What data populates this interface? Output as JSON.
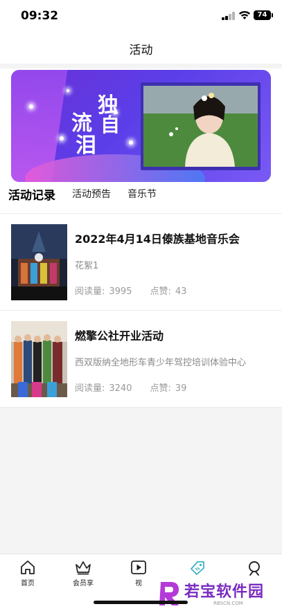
{
  "status_bar": {
    "time": "09:32",
    "battery": "74"
  },
  "header": {
    "title": "活动"
  },
  "banner": {
    "title_chars": [
      "独",
      "流",
      "自",
      "泪"
    ],
    "accent_color": "#6b2fd6"
  },
  "tabs": [
    {
      "label": "活动记录",
      "active": true
    },
    {
      "label": "活动预告",
      "active": false
    },
    {
      "label": "音乐节",
      "active": false
    }
  ],
  "activities": [
    {
      "title": "2022年4月14日傣族基地音乐会",
      "subtitle": "花絮1",
      "views_label": "阅读量:",
      "views": "3995",
      "likes_label": "点赞:",
      "likes": "43"
    },
    {
      "title": "燃擎公社开业活动",
      "subtitle": "西双版纳全地形车青少年驾控培训体验中心",
      "views_label": "阅读量:",
      "views": "3240",
      "likes_label": "点赞:",
      "likes": "39"
    }
  ],
  "tabbar": {
    "items": [
      {
        "label": "首页",
        "icon": "home-icon"
      },
      {
        "label": "会员享",
        "icon": "crown-icon"
      },
      {
        "label": "视",
        "icon": "play-icon"
      },
      {
        "label": "",
        "icon": "tag-icon"
      },
      {
        "label": "",
        "icon": "user-icon"
      }
    ]
  },
  "watermark": {
    "text": "若宝软件园",
    "sub": "RBSCN.COM"
  }
}
